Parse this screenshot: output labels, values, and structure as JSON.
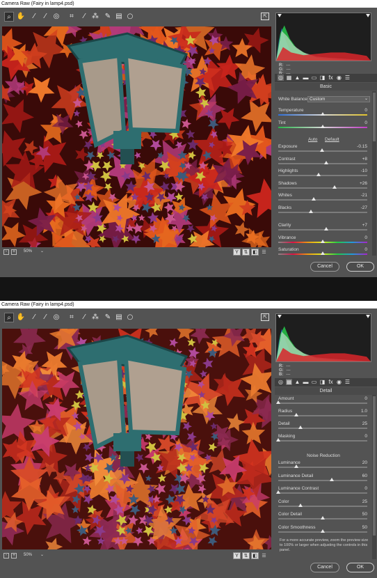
{
  "window_title": "Camera Raw (Fairy in lamp4.psd)",
  "tools": [
    {
      "name": "zoom-tool-icon",
      "glyph": "⌕"
    },
    {
      "name": "hand-tool-icon",
      "glyph": "✋"
    },
    {
      "name": "white-balance-tool-icon",
      "glyph": "⁄"
    },
    {
      "name": "color-sampler-tool-icon",
      "glyph": "⁄"
    },
    {
      "name": "targeted-adjustment-tool-icon",
      "glyph": "◎"
    },
    {
      "name": "crop-tool-icon",
      "glyph": "⌗"
    },
    {
      "name": "straighten-tool-icon",
      "glyph": "⁄"
    },
    {
      "name": "spot-removal-tool-icon",
      "glyph": "⁂"
    },
    {
      "name": "adjustment-brush-icon",
      "glyph": "✎"
    },
    {
      "name": "graduated-filter-icon",
      "glyph": "▤"
    },
    {
      "name": "radial-filter-icon",
      "glyph": "○"
    }
  ],
  "fullscreen_glyph": "⇱",
  "zoom_level": "50%",
  "zoom_minus": "-",
  "zoom_plus": "+",
  "zoom_chevron": "⌄",
  "view_buttons": [
    "Y",
    "⇅",
    "◧",
    "☰"
  ],
  "readouts": {
    "r_label": "R:",
    "g_label": "G:",
    "b_label": "B:",
    "value": "---"
  },
  "panel_tabs": [
    "◎",
    "▦",
    "▲",
    "▬",
    "▭",
    "◨",
    "fx",
    "◉",
    "☰"
  ],
  "basic": {
    "section_title": "Basic",
    "white_balance_label": "White Balance:",
    "white_balance_value": "Custom",
    "auto_label": "Auto",
    "default_label": "Default",
    "sliders": [
      {
        "label": "Temperature",
        "value": "0",
        "pos": 0.5,
        "kind": "temp"
      },
      {
        "label": "Tint",
        "value": "0",
        "pos": 0.5,
        "kind": "tint"
      },
      {
        "label": "Exposure",
        "value": "-0.15",
        "pos": 0.49,
        "kind": "plain"
      },
      {
        "label": "Contrast",
        "value": "+8",
        "pos": 0.54,
        "kind": "plain"
      },
      {
        "label": "Highlights",
        "value": "-10",
        "pos": 0.45,
        "kind": "plain"
      },
      {
        "label": "Shadows",
        "value": "+26",
        "pos": 0.63,
        "kind": "plain"
      },
      {
        "label": "Whites",
        "value": "-21",
        "pos": 0.4,
        "kind": "plain"
      },
      {
        "label": "Blacks",
        "value": "-27",
        "pos": 0.37,
        "kind": "plain"
      },
      {
        "label": "Clarity",
        "value": "+7",
        "pos": 0.54,
        "kind": "plain"
      },
      {
        "label": "Vibrance",
        "value": "0",
        "pos": 0.5,
        "kind": "vib"
      },
      {
        "label": "Saturation",
        "value": "0",
        "pos": 0.5,
        "kind": "sat"
      }
    ]
  },
  "detail": {
    "section_title": "Detail",
    "sharpening": [
      {
        "label": "Amount",
        "value": "0",
        "pos": 0.0
      },
      {
        "label": "Radius",
        "value": "1.0",
        "pos": 0.2
      },
      {
        "label": "Detail",
        "value": "25",
        "pos": 0.25
      },
      {
        "label": "Masking",
        "value": "0",
        "pos": 0.0
      }
    ],
    "noise_title": "Noise Reduction",
    "noise": [
      {
        "label": "Luminance",
        "value": "20",
        "pos": 0.2
      },
      {
        "label": "Luminance Detail",
        "value": "60",
        "pos": 0.6
      },
      {
        "label": "Luminance Contrast",
        "value": "0",
        "pos": 0.0
      },
      {
        "label": "Color",
        "value": "25",
        "pos": 0.25
      },
      {
        "label": "Color Detail",
        "value": "50",
        "pos": 0.5
      },
      {
        "label": "Color Smoothness",
        "value": "50",
        "pos": 0.5
      }
    ],
    "note": "For a more accurate preview, zoom the preview size to 100% or larger when adjusting the controls in this panel."
  },
  "buttons": {
    "cancel": "Cancel",
    "ok": "OK"
  },
  "colors": {
    "ui_gray": "#535353",
    "leaf_red": "#c8241c",
    "leaf_orange": "#e2571c",
    "leaf_magenta": "#a83a7a",
    "lamp_teal": "#2f6e70"
  }
}
